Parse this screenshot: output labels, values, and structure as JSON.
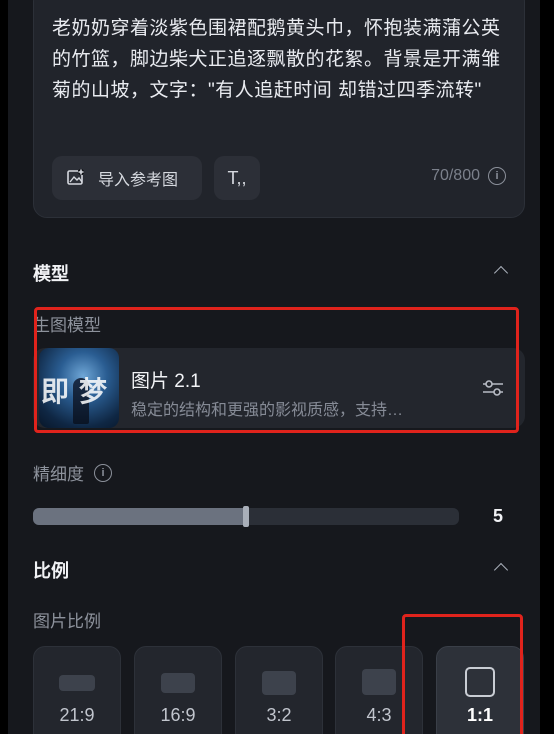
{
  "prompt": {
    "text": "老奶奶穿着淡紫色围裙配鹅黄头巾，怀抱装满蒲公英的竹篮，脚边柴犬正追逐飘散的花絮。背景是开满雏菊的山坡，文字：\"有人追赶时间 却错过四季流转\"",
    "import_label": "导入参考图",
    "text_tool_label": "T,,",
    "char_count": "70/800"
  },
  "model_section": {
    "title": "模型",
    "sub_label": "生图模型",
    "model_name": "图片 2.1",
    "model_desc": "稳定的结构和更强的影视质感，支持…",
    "thumb_text": "即梦"
  },
  "detail": {
    "label": "精细度",
    "value": "5",
    "level_fraction": 0.5
  },
  "ratio_section": {
    "title": "比例",
    "sub_label": "图片比例",
    "options": [
      {
        "label": "21:9"
      },
      {
        "label": "16:9"
      },
      {
        "label": "3:2"
      },
      {
        "label": "4:3"
      },
      {
        "label": "1:1",
        "selected": true
      }
    ]
  },
  "colors": {
    "highlight": "#e0231c",
    "panel": "#16181d",
    "card": "#23262d"
  }
}
